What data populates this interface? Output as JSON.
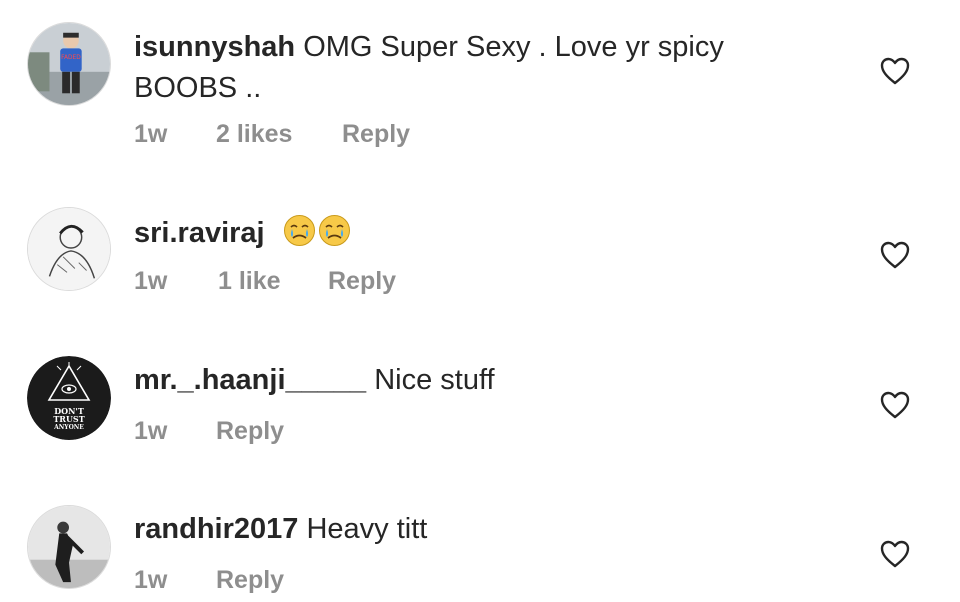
{
  "comments": [
    {
      "username": "isunnyshah",
      "text": " OMG Super Sexy . Love yr spicy BOOBS ..",
      "time": "1w",
      "likes": "2 likes",
      "reply": "Reply",
      "avatar_icon": "profile-photo-boy"
    },
    {
      "username": "sri.raviraj",
      "text": "",
      "emojis": [
        "crying-face-emoji",
        "crying-face-emoji"
      ],
      "time": "1w",
      "likes": "1 like",
      "reply": "Reply",
      "avatar_icon": "profile-sketch"
    },
    {
      "username": "mr._.haanji_____",
      "text": " Nice stuff",
      "time": "1w",
      "reply": "Reply",
      "avatar_icon": "dont-trust-anyone-eye-logo",
      "avatar_text": [
        "DON'T",
        "TRUST",
        "ANYONE"
      ]
    },
    {
      "username": "randhir2017",
      "text": " Heavy titt",
      "time": "1w",
      "reply": "Reply",
      "avatar_icon": "profile-photo-man"
    }
  ],
  "colors": {
    "text": "#262626",
    "meta": "#8e8e8e",
    "heart": "#262626"
  }
}
